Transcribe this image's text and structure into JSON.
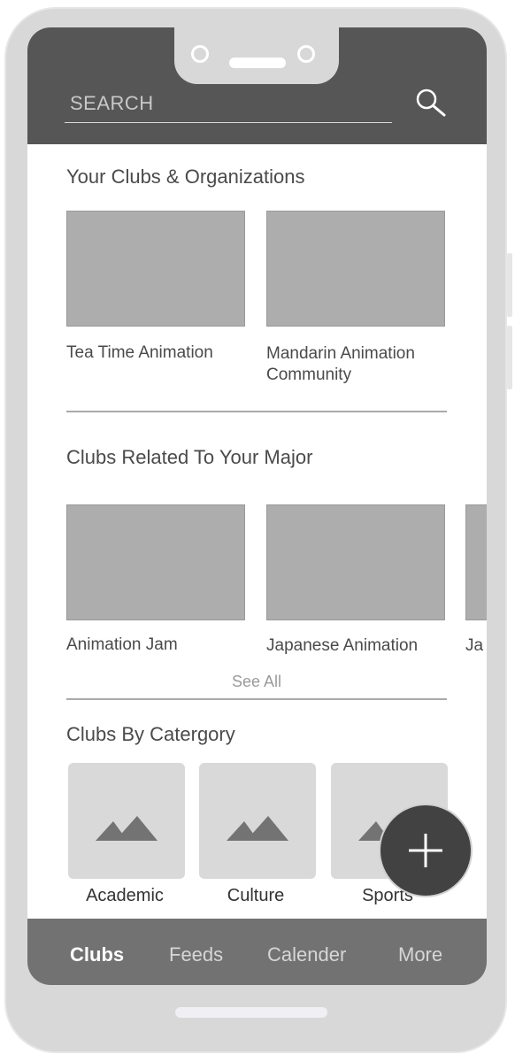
{
  "search": {
    "placeholder": "SEARCH"
  },
  "your_clubs": {
    "title": "Your Clubs & Organizations",
    "items": [
      {
        "label": "Tea Time Animation"
      },
      {
        "label": "Mandarin Animation Community"
      }
    ]
  },
  "related_clubs": {
    "title": "Clubs Related To Your Major",
    "items": [
      {
        "label": "Animation Jam"
      },
      {
        "label": "Japanese Animation"
      },
      {
        "label": "Ja"
      }
    ],
    "see_all": "See All"
  },
  "categories": {
    "title": "Clubs By Catergory",
    "items": [
      {
        "label": "Academic",
        "icon": "image-placeholder-icon"
      },
      {
        "label": "Culture",
        "icon": "image-placeholder-icon"
      },
      {
        "label": "Sports",
        "icon": "image-placeholder-icon"
      }
    ]
  },
  "fab": {
    "icon": "plus-icon"
  },
  "bottom_nav": {
    "items": [
      {
        "label": "Clubs",
        "active": true
      },
      {
        "label": "Feeds",
        "active": false
      },
      {
        "label": "Calender",
        "active": false
      },
      {
        "label": "More",
        "active": false
      }
    ]
  },
  "colors": {
    "header": "#565656",
    "nav_bar": "#727272",
    "fab": "#424242",
    "card_placeholder": "#adadad",
    "category_tile": "#d9d9d9"
  }
}
